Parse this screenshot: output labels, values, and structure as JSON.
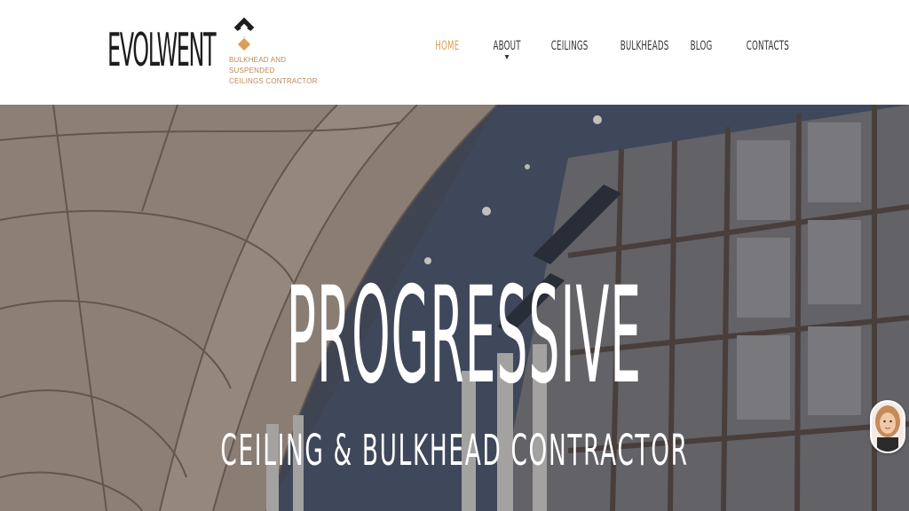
{
  "brand": {
    "name": "EVOLWENT",
    "tagline_line1": "BULKHEAD AND SUSPENDED",
    "tagline_line2": "CEILINGS CONTRACTOR"
  },
  "nav": {
    "items": [
      {
        "label": "HOME",
        "active": true
      },
      {
        "label": "ABOUT",
        "has_dropdown": true
      },
      {
        "label": "CEILINGS"
      },
      {
        "label": "BULKHEADS"
      },
      {
        "label": "BLOG"
      },
      {
        "label": "CONTACTS"
      }
    ]
  },
  "hero": {
    "title": "PROGRESSIVE",
    "subtitle": "CEILING & BULKHEAD CONTRACTOR"
  },
  "colors": {
    "accent": "#d9a05b",
    "text_dark": "#1d1d1d",
    "nav_text": "#333333",
    "hero_text": "#ffffff"
  },
  "icons": {
    "logo": "diamond-logo-icon",
    "dropdown": "caret-down-icon",
    "chat": "chat-avatar-icon"
  }
}
